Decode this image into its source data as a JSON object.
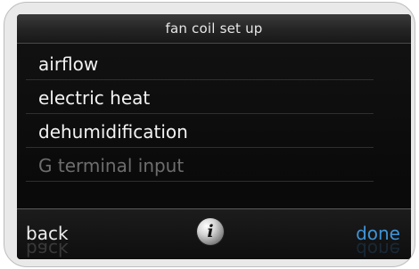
{
  "title": "fan coil set up",
  "menu": {
    "items": [
      {
        "label": "airflow",
        "enabled": true
      },
      {
        "label": "electric heat",
        "enabled": true
      },
      {
        "label": "dehumidification",
        "enabled": true
      },
      {
        "label": "G terminal input",
        "enabled": false
      }
    ]
  },
  "footer": {
    "back_label": "back",
    "info_icon": "info-icon",
    "info_glyph": "i",
    "done_label": "done"
  },
  "colors": {
    "screen_background": "#0b0b0b",
    "text": "#f2f2f2",
    "disabled_text": "#6d6d6d",
    "done_accent": "#3f93d6"
  }
}
